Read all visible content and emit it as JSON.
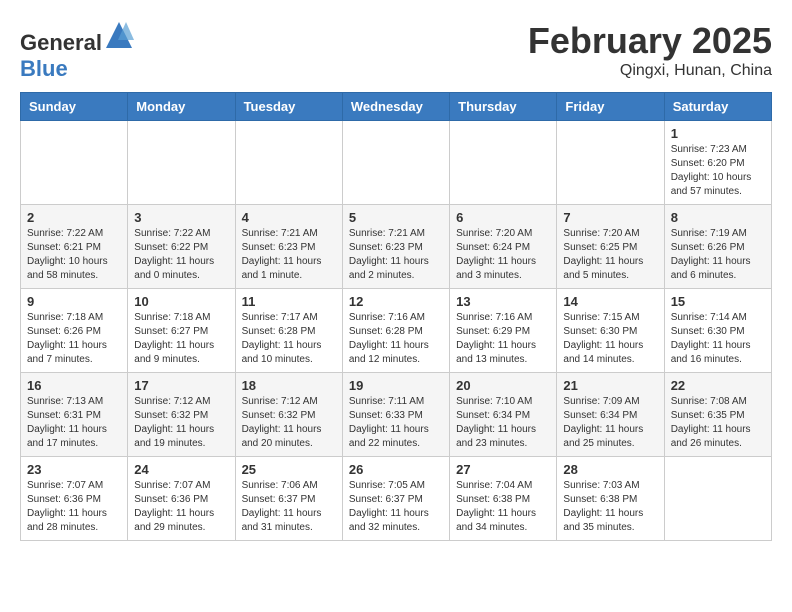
{
  "header": {
    "logo_general": "General",
    "logo_blue": "Blue",
    "month": "February 2025",
    "location": "Qingxi, Hunan, China"
  },
  "days_of_week": [
    "Sunday",
    "Monday",
    "Tuesday",
    "Wednesday",
    "Thursday",
    "Friday",
    "Saturday"
  ],
  "weeks": [
    [
      {
        "day": "",
        "info": ""
      },
      {
        "day": "",
        "info": ""
      },
      {
        "day": "",
        "info": ""
      },
      {
        "day": "",
        "info": ""
      },
      {
        "day": "",
        "info": ""
      },
      {
        "day": "",
        "info": ""
      },
      {
        "day": "1",
        "info": "Sunrise: 7:23 AM\nSunset: 6:20 PM\nDaylight: 10 hours and 57 minutes."
      }
    ],
    [
      {
        "day": "2",
        "info": "Sunrise: 7:22 AM\nSunset: 6:21 PM\nDaylight: 10 hours and 58 minutes."
      },
      {
        "day": "3",
        "info": "Sunrise: 7:22 AM\nSunset: 6:22 PM\nDaylight: 11 hours and 0 minutes."
      },
      {
        "day": "4",
        "info": "Sunrise: 7:21 AM\nSunset: 6:23 PM\nDaylight: 11 hours and 1 minute."
      },
      {
        "day": "5",
        "info": "Sunrise: 7:21 AM\nSunset: 6:23 PM\nDaylight: 11 hours and 2 minutes."
      },
      {
        "day": "6",
        "info": "Sunrise: 7:20 AM\nSunset: 6:24 PM\nDaylight: 11 hours and 3 minutes."
      },
      {
        "day": "7",
        "info": "Sunrise: 7:20 AM\nSunset: 6:25 PM\nDaylight: 11 hours and 5 minutes."
      },
      {
        "day": "8",
        "info": "Sunrise: 7:19 AM\nSunset: 6:26 PM\nDaylight: 11 hours and 6 minutes."
      }
    ],
    [
      {
        "day": "9",
        "info": "Sunrise: 7:18 AM\nSunset: 6:26 PM\nDaylight: 11 hours and 7 minutes."
      },
      {
        "day": "10",
        "info": "Sunrise: 7:18 AM\nSunset: 6:27 PM\nDaylight: 11 hours and 9 minutes."
      },
      {
        "day": "11",
        "info": "Sunrise: 7:17 AM\nSunset: 6:28 PM\nDaylight: 11 hours and 10 minutes."
      },
      {
        "day": "12",
        "info": "Sunrise: 7:16 AM\nSunset: 6:28 PM\nDaylight: 11 hours and 12 minutes."
      },
      {
        "day": "13",
        "info": "Sunrise: 7:16 AM\nSunset: 6:29 PM\nDaylight: 11 hours and 13 minutes."
      },
      {
        "day": "14",
        "info": "Sunrise: 7:15 AM\nSunset: 6:30 PM\nDaylight: 11 hours and 14 minutes."
      },
      {
        "day": "15",
        "info": "Sunrise: 7:14 AM\nSunset: 6:30 PM\nDaylight: 11 hours and 16 minutes."
      }
    ],
    [
      {
        "day": "16",
        "info": "Sunrise: 7:13 AM\nSunset: 6:31 PM\nDaylight: 11 hours and 17 minutes."
      },
      {
        "day": "17",
        "info": "Sunrise: 7:12 AM\nSunset: 6:32 PM\nDaylight: 11 hours and 19 minutes."
      },
      {
        "day": "18",
        "info": "Sunrise: 7:12 AM\nSunset: 6:32 PM\nDaylight: 11 hours and 20 minutes."
      },
      {
        "day": "19",
        "info": "Sunrise: 7:11 AM\nSunset: 6:33 PM\nDaylight: 11 hours and 22 minutes."
      },
      {
        "day": "20",
        "info": "Sunrise: 7:10 AM\nSunset: 6:34 PM\nDaylight: 11 hours and 23 minutes."
      },
      {
        "day": "21",
        "info": "Sunrise: 7:09 AM\nSunset: 6:34 PM\nDaylight: 11 hours and 25 minutes."
      },
      {
        "day": "22",
        "info": "Sunrise: 7:08 AM\nSunset: 6:35 PM\nDaylight: 11 hours and 26 minutes."
      }
    ],
    [
      {
        "day": "23",
        "info": "Sunrise: 7:07 AM\nSunset: 6:36 PM\nDaylight: 11 hours and 28 minutes."
      },
      {
        "day": "24",
        "info": "Sunrise: 7:07 AM\nSunset: 6:36 PM\nDaylight: 11 hours and 29 minutes."
      },
      {
        "day": "25",
        "info": "Sunrise: 7:06 AM\nSunset: 6:37 PM\nDaylight: 11 hours and 31 minutes."
      },
      {
        "day": "26",
        "info": "Sunrise: 7:05 AM\nSunset: 6:37 PM\nDaylight: 11 hours and 32 minutes."
      },
      {
        "day": "27",
        "info": "Sunrise: 7:04 AM\nSunset: 6:38 PM\nDaylight: 11 hours and 34 minutes."
      },
      {
        "day": "28",
        "info": "Sunrise: 7:03 AM\nSunset: 6:38 PM\nDaylight: 11 hours and 35 minutes."
      },
      {
        "day": "",
        "info": ""
      }
    ]
  ]
}
